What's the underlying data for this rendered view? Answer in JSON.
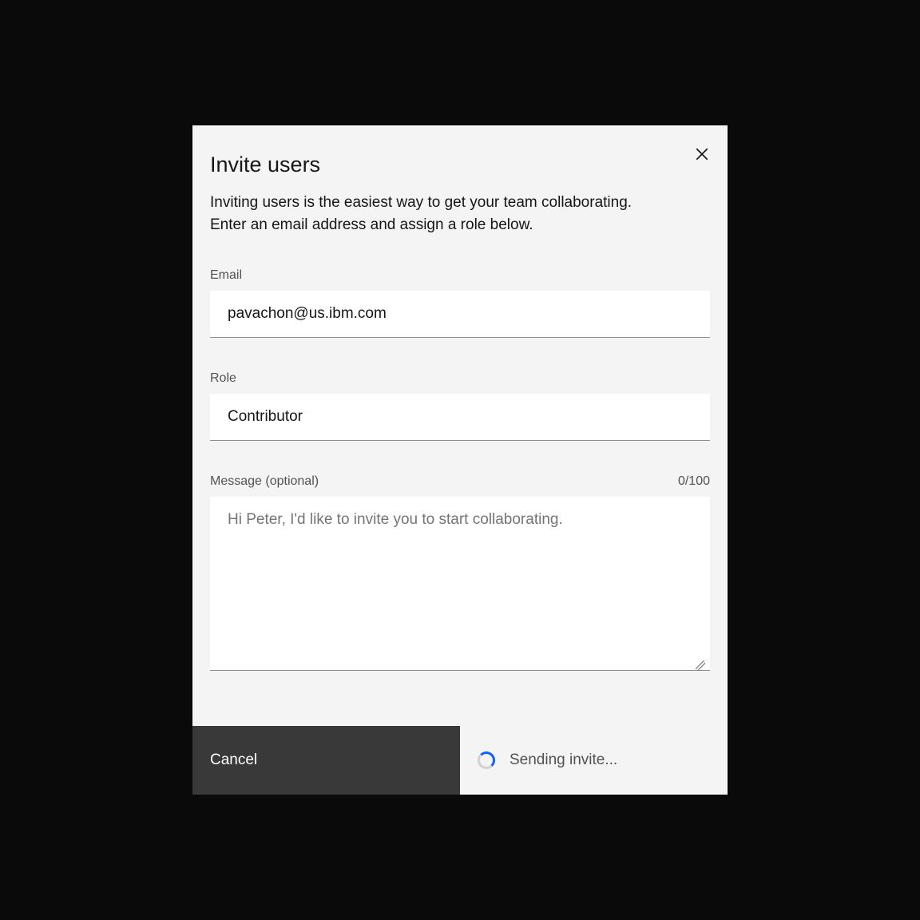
{
  "modal": {
    "title": "Invite users",
    "description": "Inviting users is the easiest way to get your team collaborating. Enter an email address and assign a role below.",
    "fields": {
      "email": {
        "label": "Email",
        "value": "pavachon@us.ibm.com"
      },
      "role": {
        "label": "Role",
        "value": "Contributor"
      },
      "message": {
        "label": "Message (optional)",
        "counter": "0/100",
        "placeholder": "Hi Peter, I'd like to invite you to start collaborating."
      }
    },
    "actions": {
      "cancel": "Cancel",
      "sending": "Sending invite..."
    }
  }
}
